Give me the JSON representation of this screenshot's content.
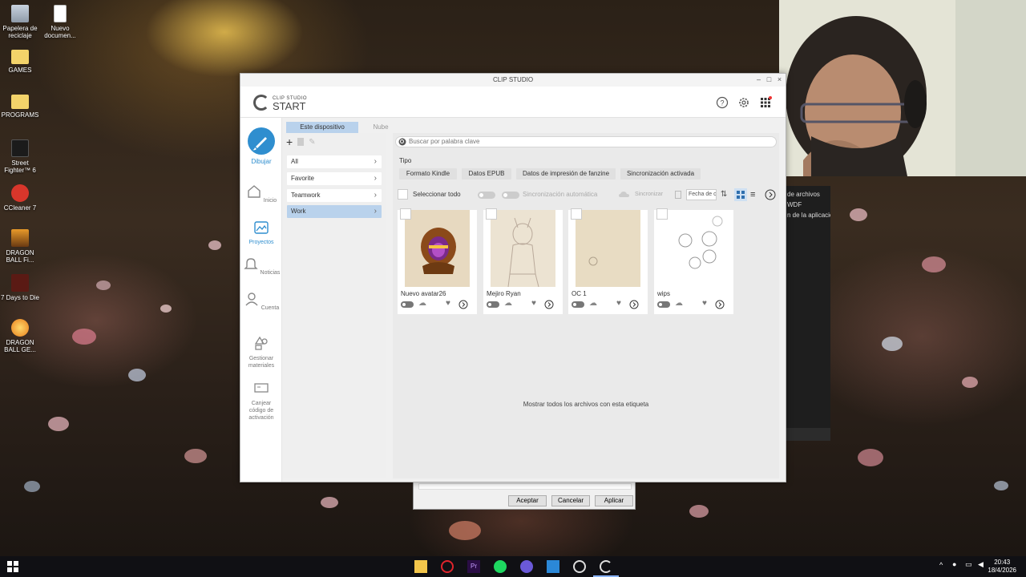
{
  "desktop": {
    "icons": [
      {
        "label": "Papelera de reciclaje",
        "icon": "recycle-bin-icon"
      },
      {
        "label": "Nuevo documen...",
        "icon": "document-icon"
      },
      {
        "label": "GAMES",
        "icon": "folder-icon"
      },
      {
        "label": "PROGRAMS",
        "icon": "folder-icon"
      },
      {
        "label": "Street Fighter™ 6",
        "icon": "street-fighter-icon"
      },
      {
        "label": "CCleaner 7",
        "icon": "ccleaner-icon"
      },
      {
        "label": "DRAGON BALL Fi...",
        "icon": "dragonball-icon"
      },
      {
        "label": "7 Days to Die",
        "icon": "7days-icon"
      },
      {
        "label": "DRAGON BALL GE...",
        "icon": "dragonball-icon"
      }
    ]
  },
  "background_panel": {
    "lines": [
      "de archivos",
      "WDF",
      "n de la aplicación"
    ]
  },
  "back_dialog": {
    "accept": "Aceptar",
    "cancel": "Cancelar",
    "apply": "Aplicar"
  },
  "window": {
    "title": "CLIP STUDIO",
    "logo_small": "CLIP STUDIO",
    "logo_big": "START",
    "header_icons": [
      "help-icon",
      "settings-icon",
      "apps-grid-icon"
    ],
    "nav": [
      {
        "label": "Dibujar",
        "icon": "brush-icon"
      },
      {
        "label": "Inicio",
        "icon": "home-icon"
      },
      {
        "label": "Proyectos",
        "icon": "projects-icon"
      },
      {
        "label": "Noticias",
        "icon": "bell-icon"
      },
      {
        "label": "Cuenta",
        "icon": "user-icon"
      },
      {
        "label": "Gestionar materiales",
        "icon": "shapes-icon"
      },
      {
        "label": "Canjear código de activación",
        "icon": "ticket-icon"
      }
    ],
    "tabs": {
      "device": "Este dispositivo",
      "cloud": "Nube"
    },
    "tags": [
      {
        "label": "All"
      },
      {
        "label": "Favorite"
      },
      {
        "label": "Teamwork"
      },
      {
        "label": "Work"
      }
    ],
    "search_placeholder": "Buscar por palabra clave",
    "tipo_label": "Tipo",
    "tipo_chips": [
      "Formato Kindle",
      "Datos EPUB",
      "Datos de impresión de fanzine",
      "Sincronización activada"
    ],
    "toolbar": {
      "select_all": "Seleccionar todo",
      "auto_sync": "Sincronización automática",
      "sync": "Sincronizar",
      "sort_field": "Fecha de c"
    },
    "cards": [
      {
        "name": "Nuevo avatar26"
      },
      {
        "name": "Mejiro Ryan"
      },
      {
        "name": "OC 1"
      },
      {
        "name": "wips"
      }
    ],
    "show_all": "Mostrar todos los archivos con esta etiqueta"
  },
  "taskbar": {
    "time": "20:43",
    "date": "18/4/2026"
  }
}
